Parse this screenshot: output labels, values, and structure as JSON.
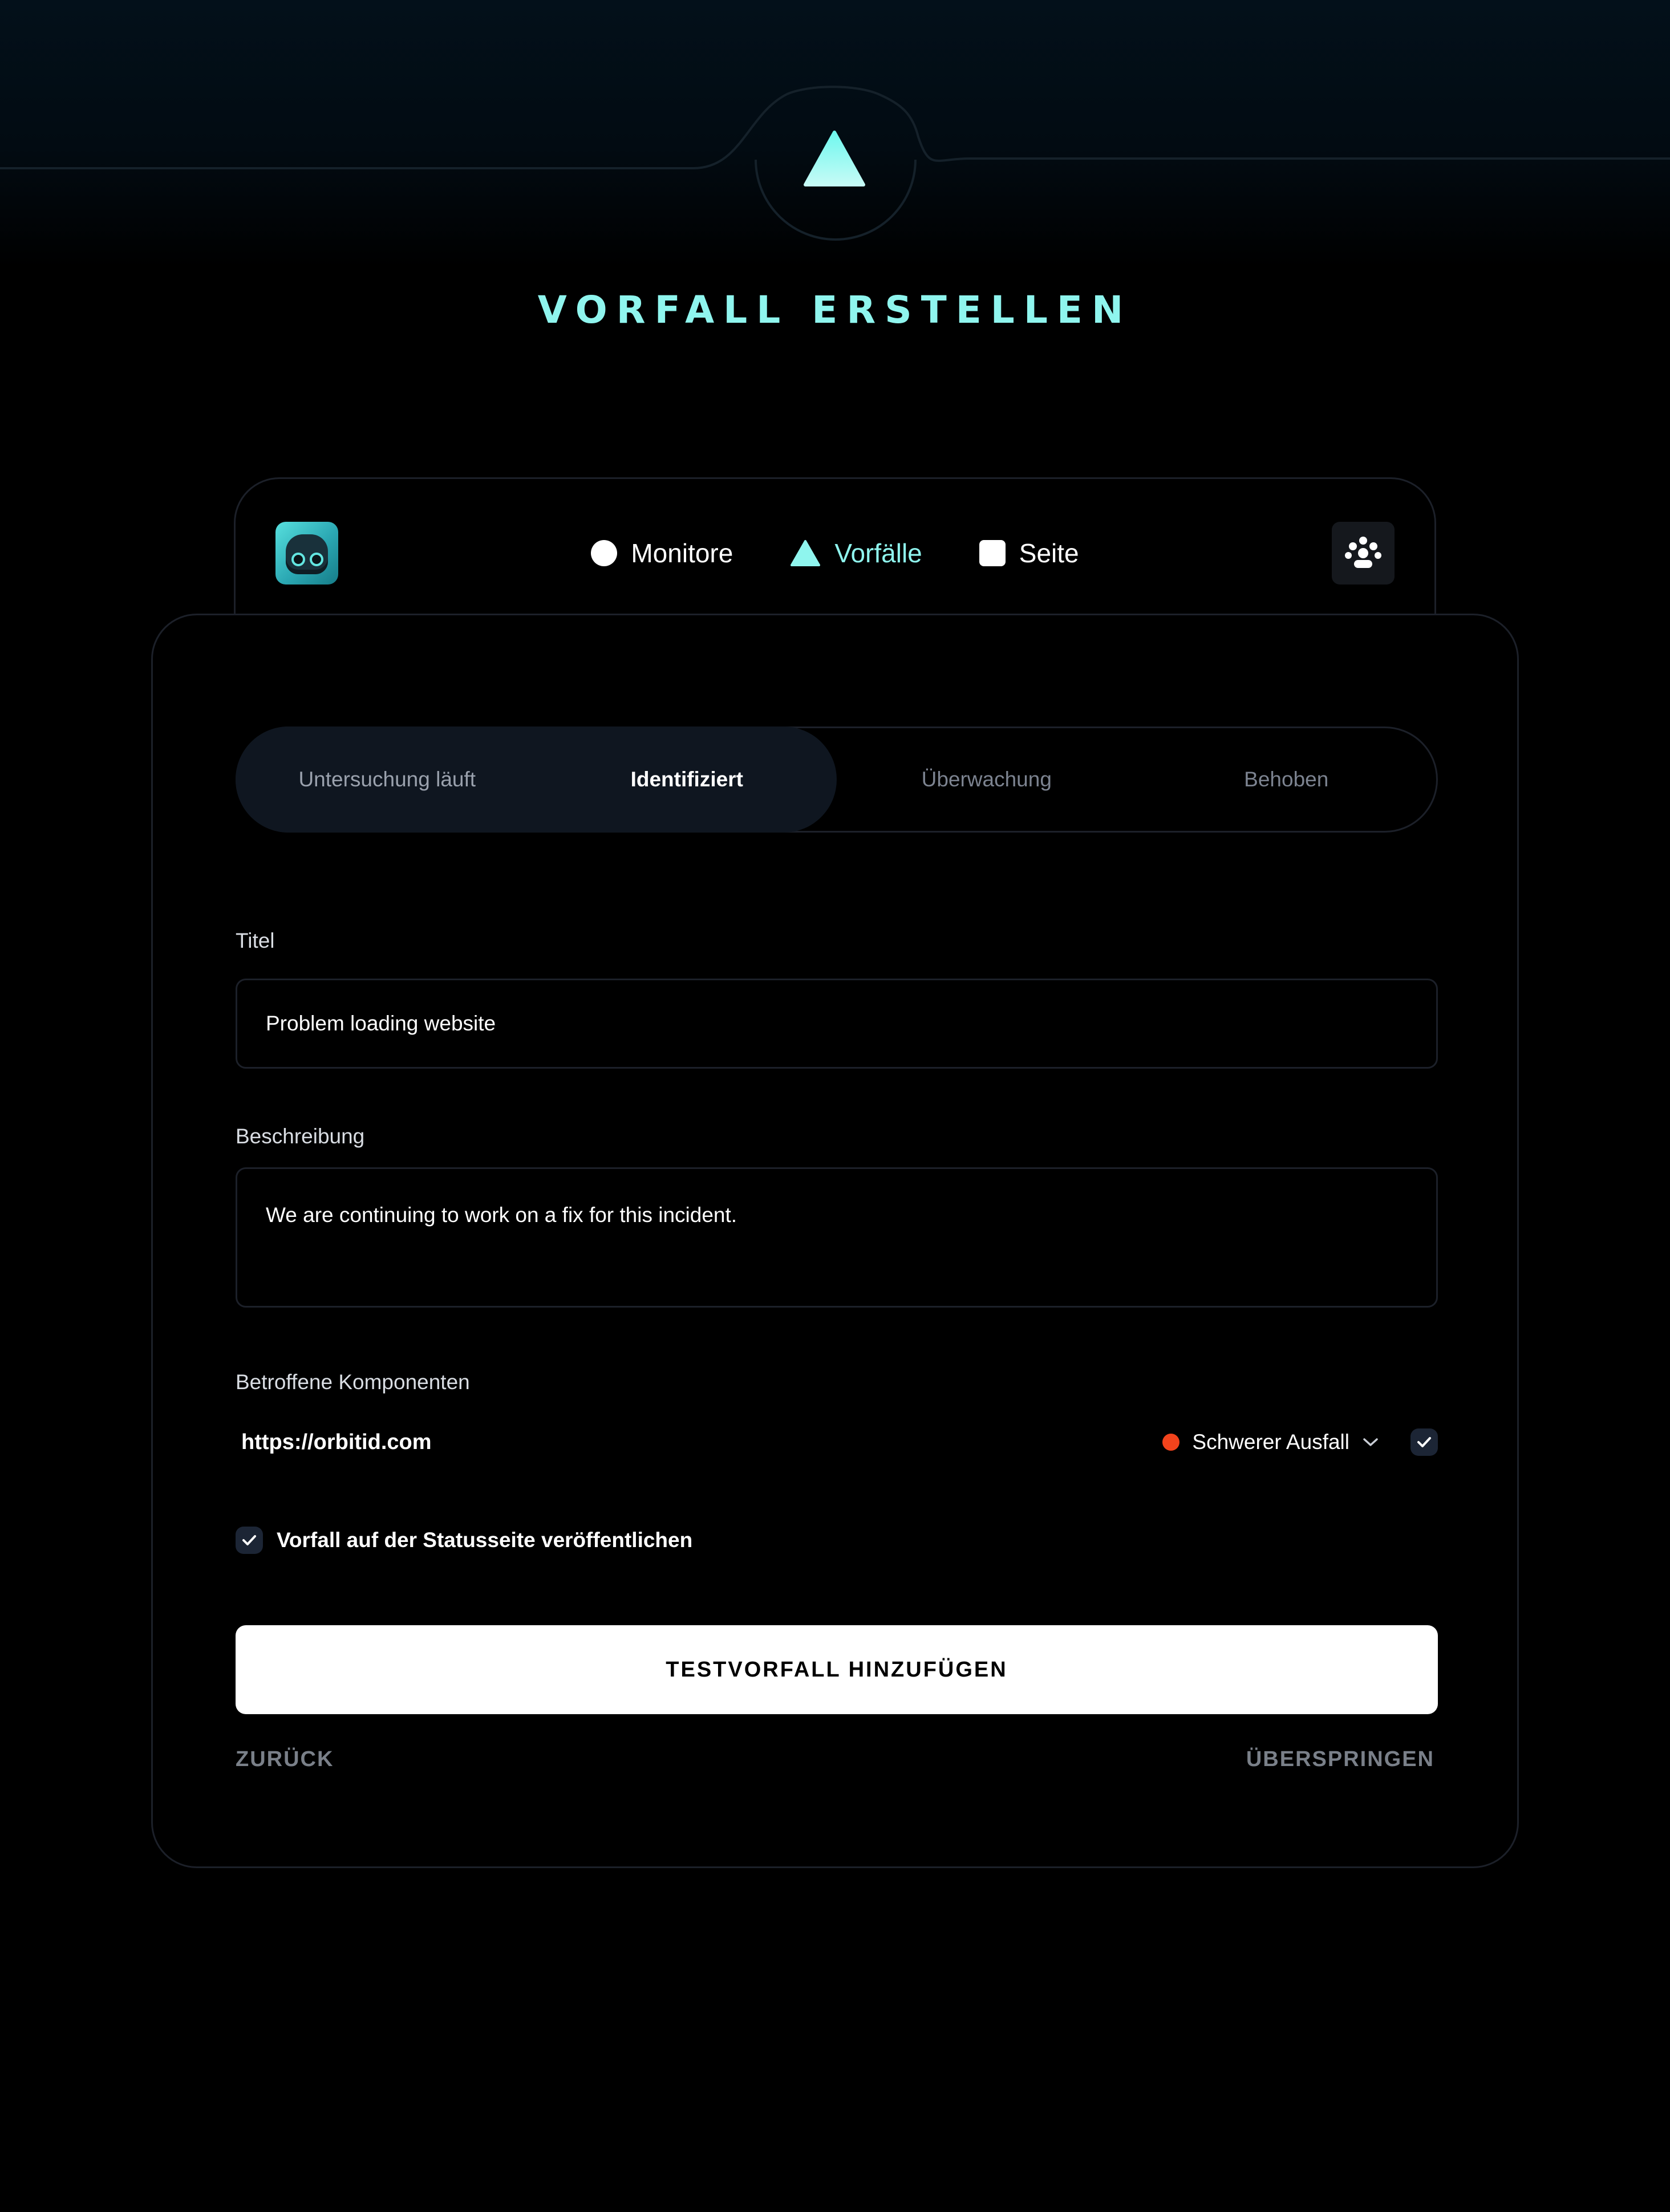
{
  "header": {
    "title": "Vorfall erstellen",
    "logo_icon": "triangle-logo-icon"
  },
  "nav": {
    "items": [
      {
        "label": "Monitore",
        "icon": "circle-icon",
        "active": false
      },
      {
        "label": "Vorfälle",
        "icon": "triangle-icon",
        "active": true
      },
      {
        "label": "Seite",
        "icon": "square-icon",
        "active": false
      }
    ],
    "avatar_icon": "robot-avatar",
    "menu_icon": "paw-icon"
  },
  "status_tabs": {
    "items": [
      "Untersuchung läuft",
      "Identifiziert",
      "Überwachung",
      "Behoben"
    ],
    "selected": "Identifiziert"
  },
  "form": {
    "title_label": "Titel",
    "title_value": "Problem loading website",
    "description_label": "Beschreibung",
    "description_value": "We are continuing to work on a fix for this incident.",
    "components_label": "Betroffene Komponenten",
    "component": {
      "url": "https://orbitid.com",
      "severity": "Schwerer Ausfall",
      "severity_color": "#f2431c",
      "checked": true
    },
    "publish_label": "Vorfall auf der Statusseite veröffentlichen",
    "publish_checked": true
  },
  "actions": {
    "submit_label": "TESTVORFALL HINZUFÜGEN",
    "back_label": "ZURÜCK",
    "skip_label": "ÜBERSPRINGEN"
  },
  "colors": {
    "accent": "#8ff5ee",
    "background": "#000000",
    "border": "#1c2029",
    "muted_text": "#7a8089"
  }
}
